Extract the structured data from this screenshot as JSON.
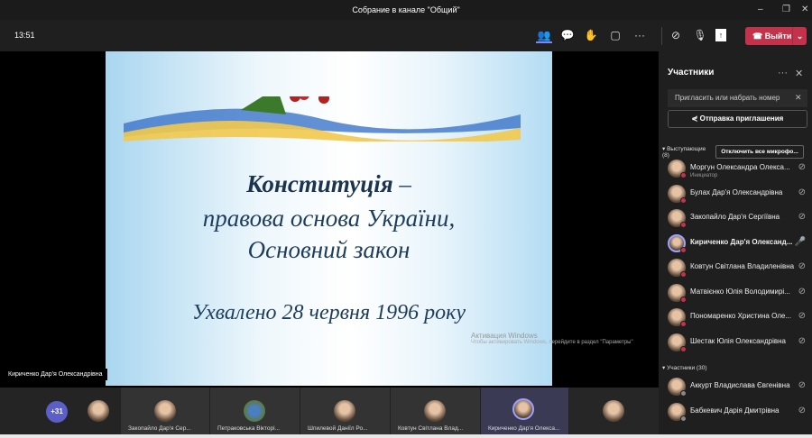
{
  "window": {
    "title": "Собрание в канале \"Общий\"",
    "minimize": "–",
    "maximize": "❐",
    "close": "✕"
  },
  "toolbar": {
    "time": "13:51",
    "leave_label": "Выйти",
    "leave_chevron": "⌄"
  },
  "slide": {
    "title": "Конституція",
    "dash": " –",
    "line2": "правова основа України,",
    "line3": "Основний закон",
    "line4": "Ухвалено 28 червня 1996 року"
  },
  "watermark": {
    "title": "Активация Windows",
    "text": "Чтобы активировать Windows, перейдите в раздел \"Параметры\""
  },
  "speaker_label": "Кириченко Дар'я Олександрівна",
  "strip": {
    "more": "+31",
    "tiles": [
      "Закопайло Дар'я Сер...",
      "Петраковська Вікторі...",
      "Шпилевой Даніїл Ро...",
      "Ковтун Світлана Влад...",
      "Кириченко Дар'я Олекса..."
    ]
  },
  "panel": {
    "title": "Участники",
    "invite_placeholder": "Пригласить или набрать номер",
    "send_invite": "Отправка приглашения",
    "presenters_label": "Выступающие (8)",
    "mute_all": "Отключить все микрофо...",
    "presenters": [
      {
        "name": "Моргун Олександра Олекса...",
        "role": "Инициатор"
      },
      {
        "name": "Булах Дар'я Олександрівна"
      },
      {
        "name": "Закопайло Дар'я Сергіївна"
      },
      {
        "name": "Кириченко Дар'я Олександ..."
      },
      {
        "name": "Ковтун Світлана Владиленівна"
      },
      {
        "name": "Матвієнко Юлія Володимирі..."
      },
      {
        "name": "Пономаренко Христина Оле..."
      },
      {
        "name": "Шестак Юлія Олександрівна"
      }
    ],
    "attendees_label": "Участники (30)",
    "attendees": [
      {
        "name": "Аккурт Владислава Євгенівна"
      },
      {
        "name": "Бабкевич Дарія Дмитрівна"
      }
    ]
  },
  "colors": {
    "leave": "#c4314b",
    "accent": "#5b5fc7"
  }
}
